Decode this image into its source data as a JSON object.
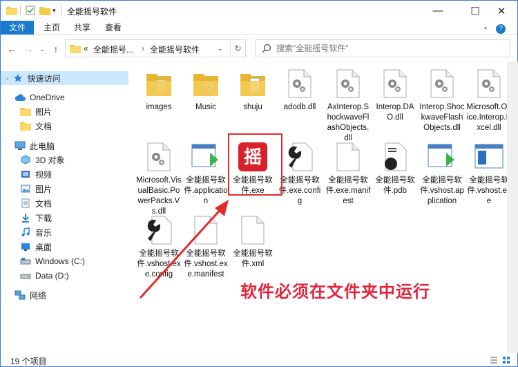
{
  "window": {
    "title": "全能摇号软件",
    "minimize": "—",
    "maximize": "☐",
    "close": "✕"
  },
  "ribbon": {
    "tabs": [
      "文件",
      "主页",
      "共享",
      "查看"
    ],
    "help": "?"
  },
  "address": {
    "breadcrumb_prefix": "«",
    "crumb1": "全能摇号...",
    "crumb2": "全能摇号软件",
    "search_placeholder": "搜索\"全能摇号软件\""
  },
  "nav": {
    "items": [
      {
        "label": "快速访问",
        "icon": "star-icon"
      },
      {
        "label": "OneDrive",
        "icon": "cloud-icon"
      },
      {
        "label": "图片",
        "icon": "folder-icon"
      },
      {
        "label": "文档",
        "icon": "folder-icon"
      },
      {
        "label": "此电脑",
        "icon": "computer-icon"
      },
      {
        "label": "3D 对象",
        "icon": "cube-icon"
      },
      {
        "label": "视频",
        "icon": "video-icon"
      },
      {
        "label": "图片",
        "icon": "picture-icon"
      },
      {
        "label": "文档",
        "icon": "document-icon"
      },
      {
        "label": "下载",
        "icon": "download-icon"
      },
      {
        "label": "音乐",
        "icon": "music-icon"
      },
      {
        "label": "桌面",
        "icon": "desktop-icon"
      },
      {
        "label": "Windows (C:)",
        "icon": "drive-icon"
      },
      {
        "label": "Data (D:)",
        "icon": "drive-icon"
      },
      {
        "label": "网络",
        "icon": "network-icon"
      }
    ]
  },
  "files": [
    {
      "name": "images",
      "type": "folder-images"
    },
    {
      "name": "Music",
      "type": "folder-music"
    },
    {
      "name": "shuju",
      "type": "folder-data"
    },
    {
      "name": "adodb.dll",
      "type": "dll"
    },
    {
      "name": "AxInterop.ShockwaveFlashObjects.dll",
      "type": "dll"
    },
    {
      "name": "Interop.DAO.dll",
      "type": "dll"
    },
    {
      "name": "Interop.ShockwaveFlashObjects.dll",
      "type": "dll"
    },
    {
      "name": "Microsoft.Office.Interop.Excel.dll",
      "type": "dll"
    },
    {
      "name": "Microsoft.VisualBasic.PowerPacks.Vs.dll",
      "type": "dll"
    },
    {
      "name": "全能摇号软件.application",
      "type": "application"
    },
    {
      "name": "全能摇号软件.exe",
      "type": "exe"
    },
    {
      "name": "全能摇号软件.exe.config",
      "type": "config"
    },
    {
      "name": "全能摇号软件.exe.manifest",
      "type": "blank"
    },
    {
      "name": "全能摇号软件.pdb",
      "type": "pdb"
    },
    {
      "name": "全能摇号软件.vshost.application",
      "type": "application"
    },
    {
      "name": "全能摇号软件.vshost.exe",
      "type": "window"
    },
    {
      "name": "全能摇号软件.vshost.exe.config",
      "type": "config"
    },
    {
      "name": "全能摇号软件.vshost.exe.manifest",
      "type": "blank"
    },
    {
      "name": "全能摇号软件.xml",
      "type": "blank"
    }
  ],
  "status": {
    "count": "19 个项目"
  },
  "annotation": {
    "text": "软件必须在文件夹中运行"
  },
  "colors": {
    "accent": "#1979ca",
    "highlight": "#e52a2a",
    "callout": "#e3243b"
  }
}
